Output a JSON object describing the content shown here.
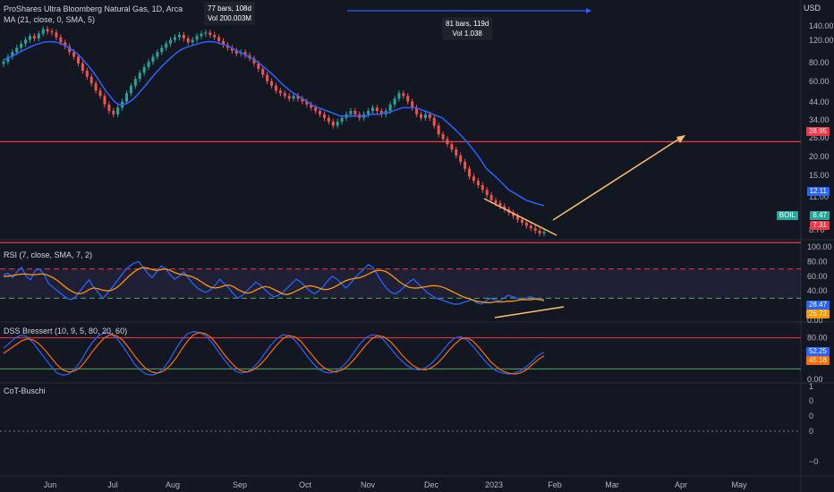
{
  "header": {
    "title": "ProShares Ultra Bloomberg Natural Gas, 1D, Arca",
    "ma_label": "MA (21, close, 0, SMA, 5)",
    "rsi_label": "RSI (7, close, SMA, 7, 2)",
    "dss_label": "DSS Bressert (10, 9, 5, 80, 20, 60)",
    "cot_label": "CoT-Buschi"
  },
  "measure_boxes": [
    {
      "bars": "77 bars, 108d",
      "vol": "Vol 200.003M"
    },
    {
      "bars": "81 bars, 119d",
      "vol": "Vol 1.038"
    }
  ],
  "price_axis": {
    "currency": "USD",
    "ticks": [
      "140.00",
      "120.00",
      "80.00",
      "60.00",
      "44.00",
      "34.00",
      "26.00",
      "20.00",
      "15.00",
      "11.00",
      "8.70"
    ]
  },
  "price_tags": {
    "resistance": "28.95",
    "ma_value": "12.11",
    "symbol": "BOIL",
    "last": "8.47",
    "support": "7.31"
  },
  "rsi_axis": {
    "ticks": [
      "100.00",
      "80.00",
      "60.00",
      "40.00",
      "20.00",
      "0.00"
    ],
    "rsi_value": "28.47",
    "ma_value": "26.72"
  },
  "dss_axis": {
    "ticks": [
      "80.00",
      "40.00",
      "0.00"
    ],
    "k_value": "52.25",
    "d_value": "45.18"
  },
  "cot_axis": {
    "ticks": [
      "1",
      "0",
      "0",
      "0",
      "−0"
    ]
  },
  "time_axis": [
    "Jun",
    "Jul",
    "Aug",
    "Sep",
    "Oct",
    "Nov",
    "Dec",
    "2023",
    "Feb",
    "Mar",
    "Apr",
    "May"
  ],
  "colors": {
    "bg": "#131722",
    "up": "#26a69a",
    "down": "#ef5350",
    "ma": "#2962ff",
    "rsi": "#2962ff",
    "rsi_ma": "#ff9800",
    "level": "#f23645",
    "trend": "#f5c16c",
    "dss_k": "#2962ff",
    "dss_d": "#ff6d00",
    "green_level": "#4caf50"
  },
  "chart_data": {
    "type": "candlestick",
    "y_scale": "log",
    "horizontal_levels": [
      28.95,
      7.31
    ],
    "closes": [
      86,
      92,
      98,
      104,
      110,
      116,
      122,
      118,
      126,
      134,
      130,
      128,
      120,
      112,
      106,
      98,
      92,
      84,
      76,
      70,
      64,
      58,
      54,
      48,
      44,
      42,
      46,
      50,
      56,
      62,
      68,
      74,
      80,
      86,
      92,
      98,
      104,
      110,
      116,
      120,
      124,
      118,
      112,
      116,
      122,
      126,
      128,
      124,
      120,
      114,
      108,
      104,
      100,
      96,
      98,
      94,
      90,
      84,
      78,
      72,
      66,
      62,
      58,
      56,
      54,
      52,
      54,
      52,
      50,
      48,
      46,
      44,
      42,
      40,
      38,
      36,
      38,
      40,
      42,
      44,
      42,
      40,
      42,
      44,
      46,
      44,
      42,
      44,
      48,
      52,
      56,
      54,
      50,
      46,
      42,
      40,
      42,
      40,
      36,
      32,
      30,
      28,
      26,
      24,
      22,
      20,
      18,
      17,
      16,
      15,
      14,
      13,
      12.5,
      12,
      11.5,
      11,
      10.5,
      10,
      9.6,
      9.2,
      8.9,
      8.6,
      8.3,
      8.47
    ],
    "ma_values": [
      88,
      90,
      93,
      96,
      99,
      102,
      105,
      108,
      110,
      112,
      113,
      113,
      112,
      110,
      107,
      103,
      99,
      94,
      88,
      82,
      76,
      70,
      64,
      58,
      54,
      50,
      48,
      48,
      49,
      51,
      54,
      58,
      62,
      67,
      72,
      77,
      82,
      87,
      92,
      97,
      101,
      104,
      106,
      108,
      110,
      112,
      113,
      113,
      112,
      110,
      108,
      105,
      102,
      99,
      96,
      93,
      90,
      87,
      83,
      79,
      75,
      71,
      67,
      63,
      60,
      57,
      55,
      53,
      51,
      49,
      47,
      46,
      45,
      44,
      43,
      42,
      41,
      41,
      41,
      41,
      41,
      41,
      41,
      42,
      42,
      42,
      43,
      43,
      44,
      45,
      46,
      46,
      46,
      46,
      45,
      44,
      43,
      42,
      41,
      40,
      38,
      36,
      34,
      32,
      30,
      28,
      26,
      24,
      22,
      20,
      19,
      18,
      17,
      16,
      15,
      14.5,
      14,
      13.5,
      13,
      12.8,
      12.5,
      12.3,
      12.11
    ],
    "rsi_values": [
      62,
      64,
      58,
      66,
      72,
      60,
      55,
      68,
      70,
      62,
      50,
      45,
      40,
      35,
      30,
      28,
      32,
      40,
      48,
      55,
      45,
      38,
      30,
      36,
      44,
      52,
      60,
      68,
      74,
      78,
      80,
      72,
      64,
      58,
      66,
      74,
      70,
      62,
      56,
      60,
      66,
      58,
      50,
      44,
      40,
      38,
      42,
      48,
      56,
      50,
      44,
      36,
      30,
      34,
      40,
      46,
      52,
      48,
      42,
      36,
      32,
      34,
      38,
      44,
      50,
      56,
      52,
      46,
      40,
      36,
      40,
      46,
      54,
      60,
      56,
      50,
      44,
      50,
      58,
      64,
      70,
      76,
      72,
      62,
      52,
      44,
      38,
      36,
      40,
      46,
      52,
      56,
      50,
      44,
      38,
      34,
      30,
      28,
      26,
      24,
      22,
      22,
      24,
      26,
      28,
      24,
      22,
      26,
      30,
      28,
      26,
      30,
      34,
      32,
      30,
      28,
      30,
      32,
      30,
      28,
      28.47
    ],
    "rsi_ma_values": [
      60,
      60,
      61,
      62,
      63,
      63,
      62,
      62,
      63,
      63,
      61,
      58,
      54,
      49,
      44,
      40,
      37,
      36,
      38,
      42,
      44,
      43,
      41,
      40,
      41,
      44,
      49,
      55,
      61,
      66,
      70,
      72,
      71,
      69,
      68,
      69,
      70,
      68,
      65,
      63,
      62,
      61,
      59,
      56,
      52,
      48,
      45,
      44,
      45,
      47,
      48,
      46,
      42,
      39,
      37,
      38,
      41,
      44,
      46,
      45,
      42,
      39,
      36,
      35,
      37,
      40,
      43,
      46,
      47,
      46,
      44,
      42,
      42,
      44,
      47,
      51,
      54,
      56,
      57,
      58,
      60,
      63,
      66,
      68,
      68,
      66,
      62,
      57,
      52,
      48,
      45,
      44,
      44,
      45,
      46,
      47,
      47,
      46,
      44,
      41,
      38,
      35,
      32,
      30,
      28,
      26,
      25,
      24,
      24,
      25,
      25,
      25,
      26,
      26,
      27,
      28,
      28,
      28,
      29,
      28,
      26.72
    ],
    "dss_k": [
      60,
      70,
      80,
      85,
      82,
      70,
      55,
      40,
      25,
      12,
      8,
      10,
      20,
      35,
      55,
      72,
      84,
      90,
      88,
      80,
      65,
      48,
      30,
      18,
      10,
      8,
      12,
      22,
      38,
      58,
      76,
      88,
      92,
      90,
      84,
      72,
      56,
      40,
      26,
      16,
      12,
      14,
      22,
      34,
      50,
      66,
      78,
      86,
      84,
      76,
      62,
      46,
      32,
      20,
      14,
      12,
      16,
      24,
      36,
      52,
      68,
      80,
      86,
      84,
      76,
      62,
      48,
      36,
      26,
      20,
      18,
      22,
      30,
      42,
      56,
      70,
      80,
      82,
      76,
      64,
      50,
      36,
      24,
      16,
      12,
      10,
      12,
      16,
      24,
      34,
      46,
      52.25
    ],
    "dss_d": [
      50,
      58,
      66,
      74,
      78,
      76,
      68,
      56,
      42,
      28,
      18,
      14,
      16,
      24,
      38,
      54,
      68,
      80,
      86,
      84,
      76,
      62,
      46,
      32,
      20,
      14,
      12,
      16,
      26,
      40,
      58,
      74,
      86,
      90,
      88,
      80,
      66,
      50,
      36,
      24,
      16,
      14,
      18,
      26,
      38,
      52,
      66,
      78,
      84,
      82,
      74,
      60,
      46,
      32,
      22,
      16,
      14,
      18,
      26,
      38,
      52,
      66,
      78,
      84,
      82,
      74,
      62,
      48,
      36,
      26,
      20,
      18,
      22,
      30,
      42,
      56,
      68,
      78,
      80,
      74,
      62,
      48,
      34,
      24,
      16,
      12,
      10,
      12,
      18,
      28,
      38,
      45.18
    ]
  }
}
